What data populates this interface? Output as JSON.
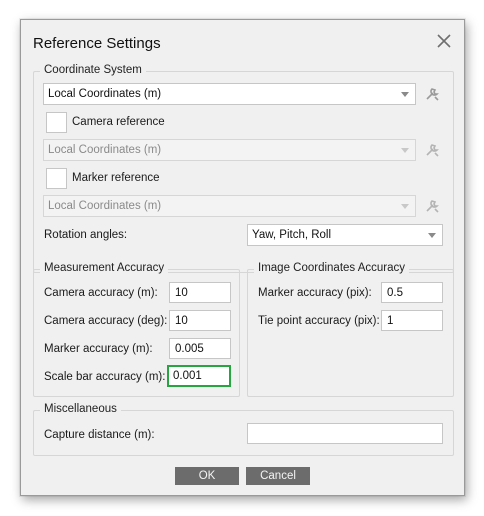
{
  "dialog": {
    "title": "Reference Settings",
    "close_icon": "close-icon"
  },
  "coordinate_system": {
    "title": "Coordinate System",
    "main_crs": "Local Coordinates (m)",
    "camera_reference_label": "Camera reference",
    "camera_reference_checked": false,
    "camera_crs": "Local Coordinates (m)",
    "marker_reference_label": "Marker reference",
    "marker_reference_checked": false,
    "marker_crs": "Local Coordinates (m)",
    "rotation_angles_label": "Rotation angles:",
    "rotation_angles_value": "Yaw, Pitch, Roll",
    "settings_icon": "wrench-icon"
  },
  "measurement_accuracy": {
    "title": "Measurement Accuracy",
    "camera_accuracy_m_label": "Camera accuracy (m):",
    "camera_accuracy_m_value": "10",
    "camera_accuracy_deg_label": "Camera accuracy (deg):",
    "camera_accuracy_deg_value": "10",
    "marker_accuracy_label": "Marker accuracy (m):",
    "marker_accuracy_value": "0.005",
    "scale_bar_accuracy_label": "Scale bar accuracy (m):",
    "scale_bar_accuracy_value": "0.001"
  },
  "image_coordinates_accuracy": {
    "title": "Image Coordinates Accuracy",
    "marker_accuracy_pix_label": "Marker accuracy (pix):",
    "marker_accuracy_pix_value": "0.5",
    "tie_point_accuracy_label": "Tie point accuracy (pix):",
    "tie_point_accuracy_value": "1"
  },
  "miscellaneous": {
    "title": "Miscellaneous",
    "capture_distance_label": "Capture distance (m):",
    "capture_distance_value": ""
  },
  "buttons": {
    "ok": "OK",
    "cancel": "Cancel"
  },
  "colors": {
    "dialog_bg": "#f0f0f0",
    "button_bg": "#6c6c6c",
    "focus_border": "#27a53f"
  }
}
